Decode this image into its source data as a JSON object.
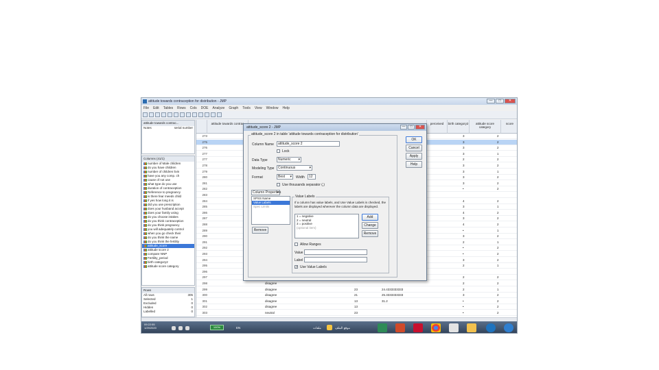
{
  "window": {
    "title": "attitude towards contraception for distribution - JMP",
    "minimize": "—",
    "maximize": "□",
    "close": "✕"
  },
  "menu": [
    "File",
    "Edit",
    "Tables",
    "Rows",
    "Cols",
    "DOE",
    "Analyze",
    "Graph",
    "Tools",
    "View",
    "Window",
    "Help"
  ],
  "left_panel": {
    "table_header": "attitude towards contrac...",
    "notes_label": "Notes",
    "notes_value": "serial number",
    "columns_header": "Columns (41/1)",
    "columns": [
      "number of Male children",
      "do you have children",
      "number of children livin",
      "have you any comp. ch",
      "cause of not use",
      "what type do you use",
      "duration of contraception",
      "Reference to pregnancy",
      "is there fear meeds child",
      "if yes how long it is",
      "did you use prescription",
      "does your husband accept",
      "does your family using",
      "do you choose intakes",
      "do you think contraception",
      "do you think pregnancy",
      "you will adequately control",
      "when you go check their",
      "do you think the name",
      "do you think the fertility",
      "attitude_score",
      "attitude score 2",
      "compare NNP",
      "Fertility_period",
      "birth category2",
      "attitude score category"
    ],
    "selected_column_index": 20,
    "rows_header": "Rows",
    "rows": [
      {
        "label": "All rows",
        "value": "305"
      },
      {
        "label": "Selected",
        "value": "1"
      },
      {
        "label": "Excluded",
        "value": "0"
      },
      {
        "label": "Hidden",
        "value": "0"
      },
      {
        "label": "Labelled",
        "value": "0"
      }
    ]
  },
  "grid": {
    "headers": [
      "attitude towards contrac",
      "perceived",
      "birth category2",
      "attitude score category",
      "score"
    ],
    "rows": [
      {
        "n": "273",
        "a": "",
        "b": "",
        "c": "3",
        "d": "2"
      },
      {
        "n": "275",
        "a": "",
        "b": "",
        "c": "3",
        "d": "2"
      },
      {
        "n": "276",
        "a": "",
        "b": "",
        "c": "3",
        "d": "2"
      },
      {
        "n": "277",
        "a": "",
        "b": "",
        "c": "3",
        "d": "1"
      },
      {
        "n": "277",
        "a": "",
        "b": "",
        "c": "2",
        "d": "2"
      },
      {
        "n": "278",
        "a": "",
        "b": "",
        "c": "3",
        "d": "2"
      },
      {
        "n": "279",
        "a": "",
        "b": "",
        "c": "3",
        "d": "1"
      },
      {
        "n": "280",
        "a": "",
        "b": "",
        "c": "3",
        "d": "2"
      },
      {
        "n": "281",
        "a": "",
        "b": "",
        "c": "3",
        "d": "2"
      },
      {
        "n": "282",
        "a": "",
        "b": "",
        "c": "•",
        "d": "2"
      },
      {
        "n": "283",
        "a": "",
        "b": "",
        "c": "",
        "d": ""
      },
      {
        "n": "284",
        "a": "",
        "b": "",
        "c": "4",
        "d": "2"
      },
      {
        "n": "285",
        "a": "",
        "b": "",
        "c": "3",
        "d": "1"
      },
      {
        "n": "286",
        "a": "",
        "b": "",
        "c": "4",
        "d": "2"
      },
      {
        "n": "287",
        "a": "",
        "b": "",
        "c": "3",
        "d": "2"
      },
      {
        "n": "288",
        "a": "",
        "b": "",
        "c": "4",
        "d": "2"
      },
      {
        "n": "289",
        "a": "",
        "b": "",
        "c": "•",
        "d": "1"
      },
      {
        "n": "290",
        "a": "",
        "b": "",
        "c": "3",
        "d": "2"
      },
      {
        "n": "291",
        "a": "",
        "b": "",
        "c": "2",
        "d": "1"
      },
      {
        "n": "292",
        "a": "",
        "b": "",
        "c": "•",
        "d": "2"
      },
      {
        "n": "293",
        "a": "",
        "b": "",
        "c": "•",
        "d": "2"
      },
      {
        "n": "294",
        "a": "",
        "b": "",
        "c": "3",
        "d": "2"
      },
      {
        "n": "295",
        "a": "",
        "b": "",
        "c": "2",
        "d": "1"
      },
      {
        "n": "296",
        "a": "",
        "b": "",
        "c": "",
        "d": ""
      },
      {
        "n": "297",
        "a": "",
        "b": "",
        "c": "2",
        "d": "2"
      },
      {
        "n": "298",
        "a": "disagree",
        "b": "",
        "c": "2",
        "d": "2"
      },
      {
        "n": "299",
        "a": "disagree",
        "b": "23",
        "c": "2",
        "d": "1"
      },
      {
        "n": "300",
        "a": "disagree",
        "b": "21",
        "c": "3",
        "d": "2"
      },
      {
        "n": "301",
        "a": "disagree",
        "b": "13",
        "c": "•",
        "d": "2"
      },
      {
        "n": "302",
        "a": "disagree",
        "b": "13",
        "c": "•",
        "d": "2"
      },
      {
        "n": "303",
        "a": "neutral",
        "b": "23",
        "c": "•",
        "d": "2"
      }
    ],
    "extra_values": [
      "24.4333333333",
      "25.3333333333",
      "31.2"
    ]
  },
  "dialog": {
    "title": "attitude_score 2 - JMP",
    "frame_legend": "attitude_score 2 in table 'attitude towards contraception for distribution'",
    "column_name_label": "Column Name",
    "column_name_value": "attitude_score 2",
    "lock_label": "Lock",
    "data_type_label": "Data Type",
    "data_type_value": "Numeric",
    "modeling_type_label": "Modeling Type",
    "modeling_type_value": "Continuous",
    "format_label": "Format",
    "format_value": "Best",
    "width_label": "Width",
    "width_value": "12",
    "thousands_label": "Use thousands separator (,)",
    "column_properties_label": "Column Properties",
    "properties": [
      "SPSS Name",
      "Value Labels",
      "Spec Limits"
    ],
    "remove_label": "Remove",
    "value_labels_legend": "Value Labels",
    "value_labels_desc": "If a column has value labels, and Use Value Labels is checked, the labels are displayed wherever the column data are displayed.",
    "value_labels": [
      "1 = negative",
      "2 = neutral",
      "3 = positive",
      "(optional item)"
    ],
    "add_label": "Add",
    "change_label": "Change",
    "remove_vl_label": "Remove",
    "allow_ranges_label": "Allow Ranges",
    "value_label": "Value",
    "label_label": "Label",
    "use_value_labels_label": "Use Value Labels",
    "ok_label": "OK",
    "cancel_label": "Cancel",
    "apply_label": "Apply",
    "help_label": "Help"
  },
  "taskbar": {
    "clock_time": "09:22:55",
    "clock_date": "1/29/2020",
    "lang": "EN",
    "folder1": "ملفات",
    "folder2": "موقع الملف",
    "battery": "100%"
  }
}
